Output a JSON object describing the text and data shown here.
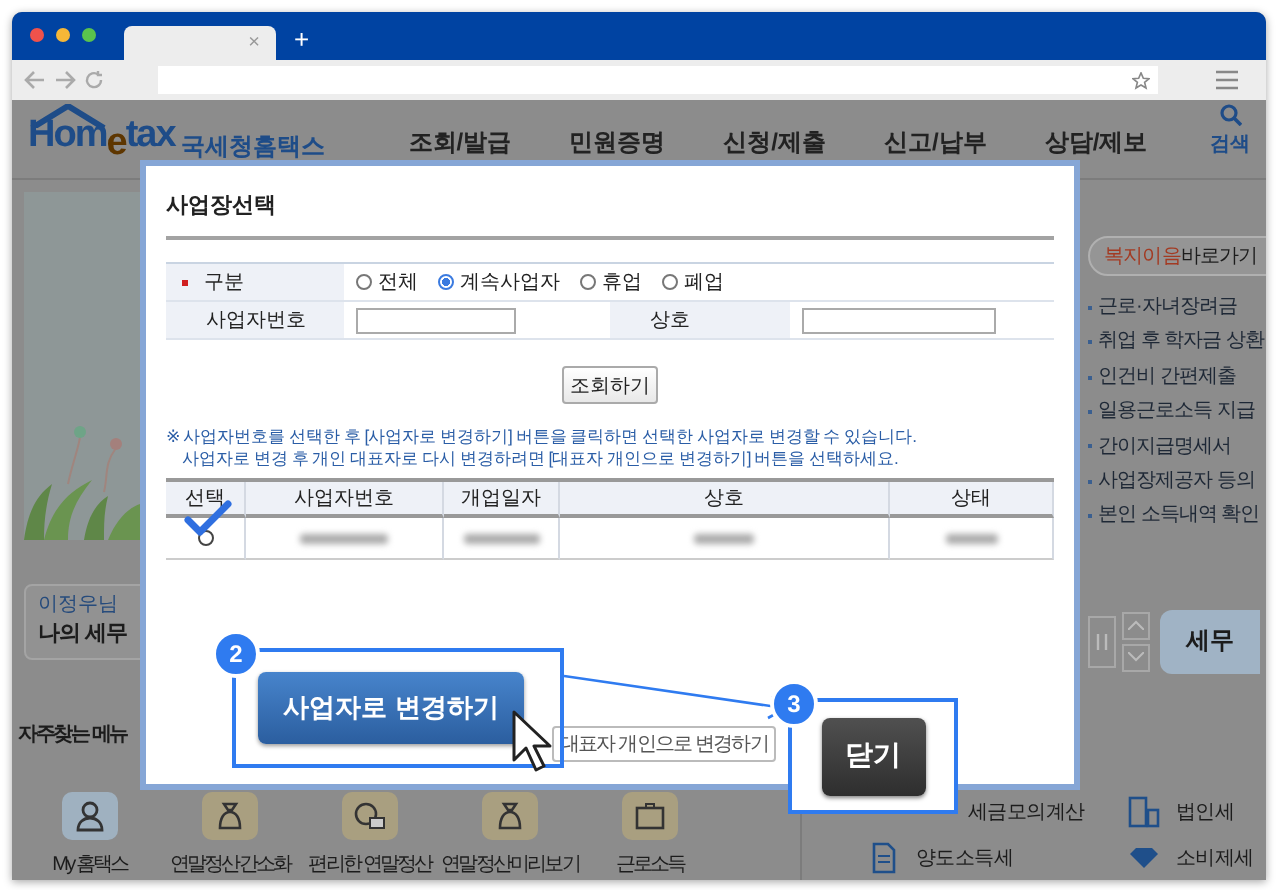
{
  "browser": {
    "tab_close": "×",
    "new_tab": "+"
  },
  "site": {
    "logo": "Hom$_{e}$tax",
    "logo_name": "국세청홈택스",
    "nav": [
      "조회/발급",
      "민원증명",
      "신청/제출",
      "신고/납부",
      "상담/제보"
    ],
    "search": "검색",
    "welfare": {
      "highlight": "복지이음",
      "label": "바로가기"
    },
    "quick_links": [
      "근로·자녀장려금",
      "취업 후 학자금 상환",
      "인건비 간편제출",
      "일용근로소득 지급",
      "간이지급명세서",
      "사업장제공자 등의",
      "본인 소득내역 확인"
    ],
    "user": {
      "greeting": "이정우님",
      "title": "나의 세무"
    },
    "tax_button": "세무",
    "frequent_menu": {
      "title": "자주찾는 메뉴",
      "items": [
        {
          "label": "My 홈택스",
          "kind": "person"
        },
        {
          "label": "연말정산간소화",
          "kind": "bag"
        },
        {
          "label": "편리한 연말정산",
          "kind": "chat"
        },
        {
          "label": "연말정산미리보기",
          "kind": "bag"
        },
        {
          "label": "근로소득",
          "kind": "briefcase"
        }
      ]
    },
    "tax_menu": [
      {
        "label": "세금모의계산",
        "kind": "none"
      },
      {
        "label": "법인세",
        "kind": "building"
      },
      {
        "label": "양도소득세",
        "kind": "document"
      },
      {
        "label": "소비제세",
        "kind": "gem"
      }
    ]
  },
  "dialog": {
    "title": "사업장선택",
    "filter": {
      "label": "구분",
      "options": [
        {
          "label": "전체",
          "selected": false
        },
        {
          "label": "계속사업자",
          "selected": true
        },
        {
          "label": "휴업",
          "selected": false
        },
        {
          "label": "폐업",
          "selected": false
        }
      ]
    },
    "fields": [
      {
        "label": "사업자번호"
      },
      {
        "label": "상호"
      }
    ],
    "query_button": "조회하기",
    "notes": [
      "※ 사업자번호를 선택한 후 [사업자로 변경하기] 버튼을 클릭하면 선택한 사업자로 변경할 수 있습니다.",
      "사업자로 변경 후 개인 대표자로 다시 변경하려면 [대표자 개인으로 변경하기] 버튼을 선택하세요."
    ],
    "columns": [
      "선택",
      "사업자번호",
      "개업일자",
      "상호",
      "상태"
    ],
    "rows": [
      {
        "selected": true
      }
    ],
    "buttons": [
      "사업자로 변경하기",
      "대표자 개인으로 변경하기"
    ]
  },
  "callouts": [
    {
      "number": "2"
    },
    {
      "number": "3",
      "button": "닫기"
    }
  ]
}
